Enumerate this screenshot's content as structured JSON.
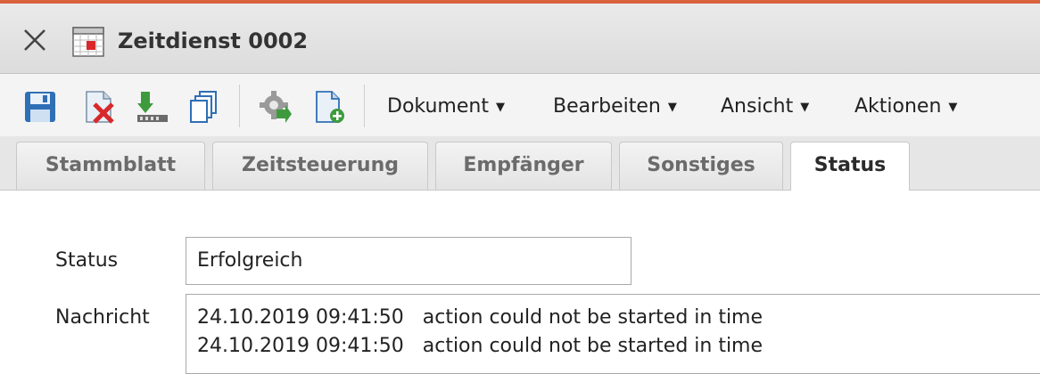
{
  "window": {
    "title": "Zeitdienst 0002",
    "close_icon": "close-x-icon",
    "doc_icon": "calendar-icon"
  },
  "toolbar": {
    "buttons": [
      {
        "icon": "save-icon"
      },
      {
        "icon": "delete-document-icon"
      },
      {
        "icon": "download-icon"
      },
      {
        "icon": "copy-icon"
      },
      {
        "icon": "settings-run-icon"
      },
      {
        "icon": "new-document-icon"
      }
    ],
    "menus": {
      "dokument": "Dokument",
      "bearbeiten": "Bearbeiten",
      "ansicht": "Ansicht",
      "aktionen": "Aktionen"
    },
    "caret": "▼"
  },
  "tabs": [
    {
      "label": "Stammblatt"
    },
    {
      "label": "Zeitsteuerung"
    },
    {
      "label": "Empfänger"
    },
    {
      "label": "Sonstiges"
    },
    {
      "label": "Status",
      "active": true
    }
  ],
  "form": {
    "status_label": "Status",
    "status_value": "Erfolgreich",
    "message_label": "Nachricht",
    "messages": [
      "24.10.2019 09:41:50   action could not be started in time",
      "24.10.2019 09:41:50   action could not be started in time"
    ]
  },
  "colors": {
    "accent_top": "#d9623f",
    "save_blue": "#2f6fb5",
    "delete_red": "#d8282b"
  }
}
